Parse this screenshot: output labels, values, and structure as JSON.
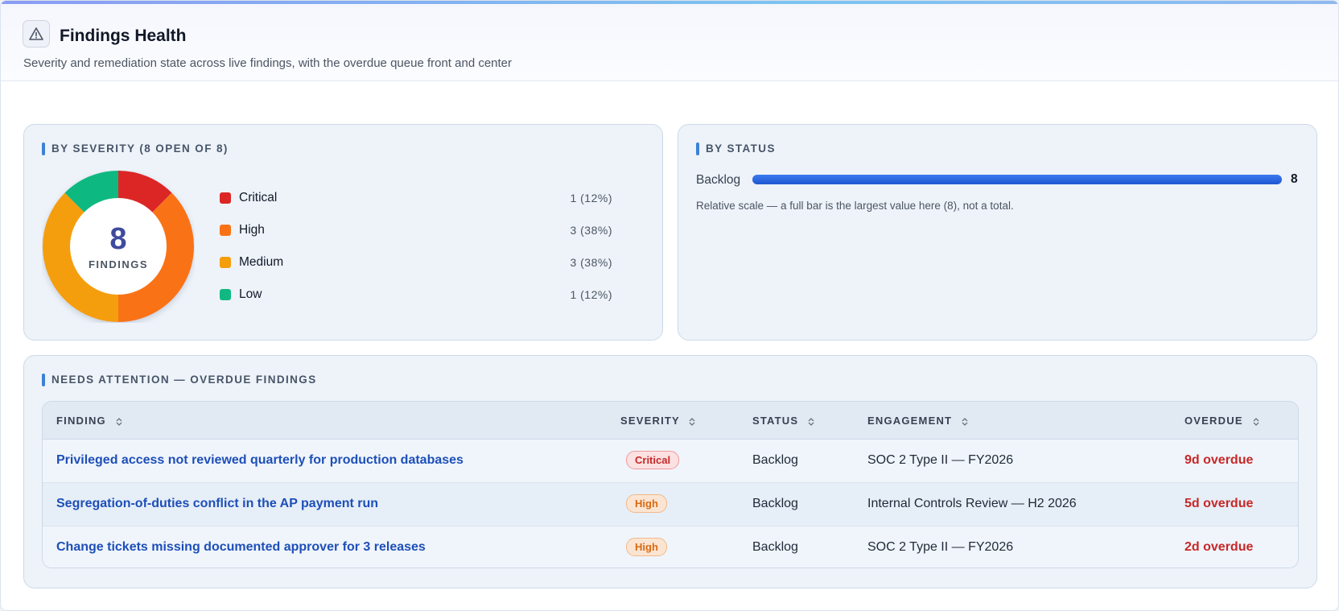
{
  "header": {
    "title": "Findings Health",
    "subtitle": "Severity and remediation state across live findings, with the overdue queue front and center",
    "icon": "warning-triangle-icon"
  },
  "severity_card": {
    "title": "BY SEVERITY (8 OPEN OF 8)",
    "total": "8",
    "total_label": "FINDINGS",
    "items": [
      {
        "name": "Critical",
        "value": "1 (12%)",
        "count": 1,
        "color": "#dc2626"
      },
      {
        "name": "High",
        "value": "3 (38%)",
        "count": 3,
        "color": "#f97316"
      },
      {
        "name": "Medium",
        "value": "3 (38%)",
        "count": 3,
        "color": "#f59e0b"
      },
      {
        "name": "Low",
        "value": "1 (12%)",
        "count": 1,
        "color": "#10b981"
      }
    ]
  },
  "status_card": {
    "title": "BY STATUS",
    "bars": [
      {
        "label": "Backlog",
        "value": "8",
        "fraction": 1.0
      }
    ],
    "note": "Relative scale — a full bar is the largest value here (8), not a total."
  },
  "attention_card": {
    "title": "NEEDS ATTENTION — OVERDUE FINDINGS",
    "columns": [
      "FINDING",
      "SEVERITY",
      "STATUS",
      "ENGAGEMENT",
      "OVERDUE"
    ],
    "rows": [
      {
        "finding": "Privileged access not reviewed quarterly for production databases",
        "severity": "Critical",
        "status": "Backlog",
        "engagement": "SOC 2 Type II — FY2026",
        "overdue": "9d overdue"
      },
      {
        "finding": "Segregation-of-duties conflict in the AP payment run",
        "severity": "High",
        "status": "Backlog",
        "engagement": "Internal Controls Review — H2 2026",
        "overdue": "5d overdue"
      },
      {
        "finding": "Change tickets missing documented approver for 3 releases",
        "severity": "High",
        "status": "Backlog",
        "engagement": "SOC 2 Type II — FY2026",
        "overdue": "2d overdue"
      }
    ]
  }
}
